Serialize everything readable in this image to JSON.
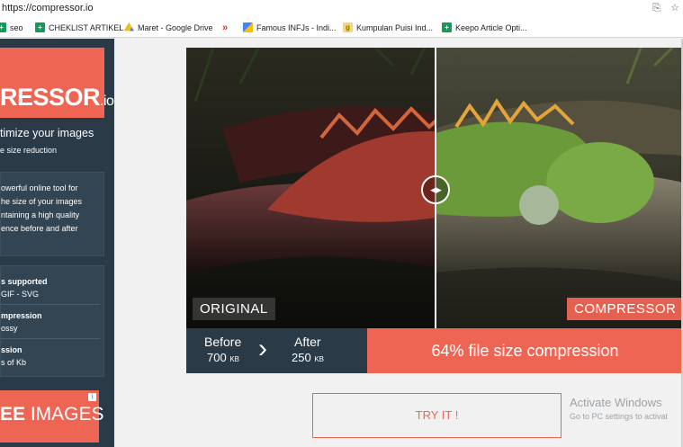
{
  "browser": {
    "url": "https://compressor.io",
    "icons": [
      "translate-icon",
      "star-icon"
    ],
    "bookmarks": [
      {
        "label": "seo",
        "icon": "bookmark-green-icon",
        "color": "#0f9d58"
      },
      {
        "label": "CHEKLIST ARTIKEL",
        "icon": "bookmark-green-icon",
        "color": "#0f9d58"
      },
      {
        "label": "Maret - Google Drive",
        "icon": "google-drive-icon",
        "color": "#fbbc04"
      },
      {
        "label": "",
        "icon": "double-chevron-icon",
        "color": "#d93025"
      },
      {
        "label": "Famous INFJs - Indi...",
        "icon": "bookmark-multicolor-icon",
        "color": "#4285f4"
      },
      {
        "label": "Kumpulan Puisi Ind...",
        "icon": "g-icon",
        "color": "#e8b100"
      },
      {
        "label": "Keepo Article Opti...",
        "icon": "bookmark-green-icon",
        "color": "#0f9d58"
      }
    ]
  },
  "sidebar": {
    "logo_main": "RESSOR",
    "logo_suffix": ".io",
    "tagline": "timize your images",
    "subtagline": "e size reduction",
    "description": [
      "owerful online tool for",
      "he size of your images",
      "ntaining a high quality",
      "ence before and after"
    ],
    "features": [
      {
        "title": "s supported",
        "value": "GIF - SVG"
      },
      {
        "title": "mpression",
        "value": "ossy"
      },
      {
        "title": "ssion",
        "value": "s of Kb"
      }
    ],
    "ad": {
      "bold": "EE",
      "text": " IMAGES",
      "badge": "i"
    }
  },
  "main": {
    "label_original": "ORIGINAL",
    "label_compressor": "COMPRESSOR",
    "before_label": "Before",
    "before_value": "700",
    "before_unit": "KB",
    "after_label": "After",
    "after_value": "250",
    "after_unit": "KB",
    "compression_text": "64% file size compression",
    "try_button": "TRY IT !",
    "activate_title": "Activate Windows",
    "activate_sub": "Go to PC settings to activat"
  },
  "colors": {
    "accent": "#ef6554",
    "dark": "#2b3a47"
  }
}
